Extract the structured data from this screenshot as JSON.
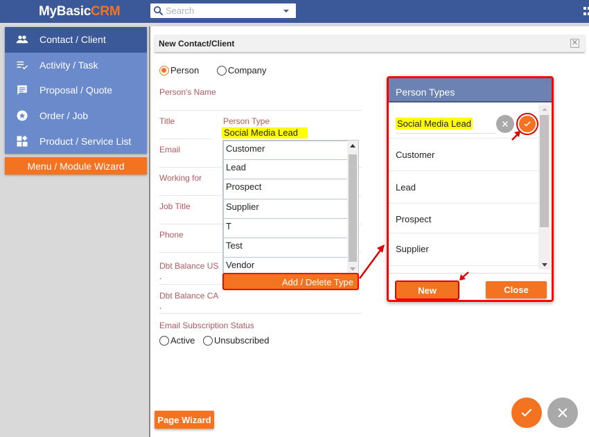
{
  "app": {
    "logo_main": "MyBasic",
    "logo_accent": "CRM",
    "search_placeholder": "Search"
  },
  "sidebar": {
    "items": [
      {
        "label": "Contact / Client",
        "icon": "people-icon",
        "active": true
      },
      {
        "label": "Activity / Task",
        "icon": "checklist-icon",
        "active": false
      },
      {
        "label": "Proposal / Quote",
        "icon": "chat-icon",
        "active": false
      },
      {
        "label": "Order / Job",
        "icon": "star-icon",
        "active": false
      },
      {
        "label": "Product / Service List",
        "icon": "widgets-icon",
        "active": false
      }
    ],
    "wizard_label": "Menu / Module Wizard"
  },
  "form": {
    "title": "New Contact/Client",
    "entity_types": [
      {
        "label": "Person",
        "selected": true
      },
      {
        "label": "Company",
        "selected": false
      }
    ],
    "fields": {
      "name": "Person's Name",
      "title": "Title",
      "email": "Email",
      "working_for": "Working for",
      "job_title": "Job Title",
      "phone": "Phone",
      "dbt_us": "Dbt Balance US",
      "dbt_us_value": ".",
      "dbt_ca": "Dbt Balance CA",
      "dbt_ca_value": ".",
      "email_status": "Email Subscription Status"
    },
    "subscription_options": [
      {
        "label": "Active",
        "selected": false
      },
      {
        "label": "Unsubscribed",
        "selected": false
      }
    ],
    "person_type_label": "Person Type",
    "person_type_value": "Social Media Lead",
    "person_type_options": [
      "Customer",
      "Lead",
      "Prospect",
      "Supplier",
      "T",
      "Test",
      "Vendor"
    ],
    "add_delete_label": "Add / Delete Type",
    "page_wizard_label": "Page Wizard"
  },
  "dialog": {
    "title": "Person Types",
    "edit_value": "Social Media Lead",
    "items": [
      "Customer",
      "Lead",
      "Prospect",
      "Supplier"
    ],
    "new_label": "New",
    "close_label": "Close"
  },
  "colors": {
    "brand_blue": "#3b5998",
    "sidebar_blue": "#6b8acb",
    "accent_orange": "#f47321",
    "highlight_yellow": "#ffff00",
    "annotation_red": "#ff0000"
  }
}
